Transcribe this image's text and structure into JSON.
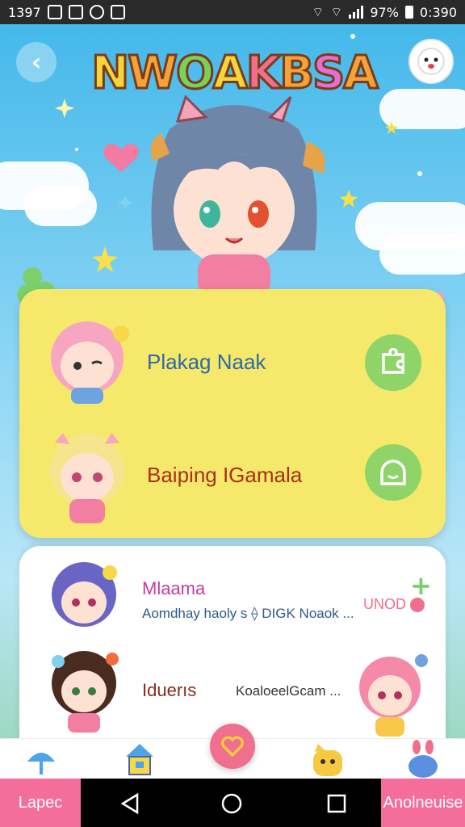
{
  "status_bar": {
    "time_left": "1397",
    "battery": "97%",
    "time_right": "0:390"
  },
  "header": {
    "title_letters": [
      "N",
      "W",
      "O",
      "A",
      "K",
      "B",
      "S",
      "A"
    ],
    "title_colors": [
      "#f6d43a",
      "#f6a23a",
      "#7ad05a",
      "#f6d43a",
      "#f06e8e",
      "#f6a23a",
      "#e36fd1",
      "#f6a23a"
    ],
    "back_icon": "back-arrow-icon",
    "avatar_icon": "ghost-face-icon"
  },
  "yellow_card": {
    "rows": [
      {
        "label": "Plakag Naak",
        "action_icon": "puzzle-icon"
      },
      {
        "label": "Baiping IGamala",
        "action_icon": "slime-face-icon"
      }
    ]
  },
  "white_card": {
    "rows": [
      {
        "title": "Mlaama",
        "subtitle": "Aomdhay haoly s ⟠ DIGK Noaok ...",
        "badge": "UNOD"
      },
      {
        "title": "Iduerıs",
        "subtitle": "KoaloeelGcam ..."
      }
    ]
  },
  "bottom_nav": {
    "left_label": "Lapec",
    "right_label": "Anolneuise"
  },
  "colors": {
    "accent_pink": "#f06e8e",
    "card_yellow": "#f6e86a",
    "action_green": "#8ed468"
  }
}
